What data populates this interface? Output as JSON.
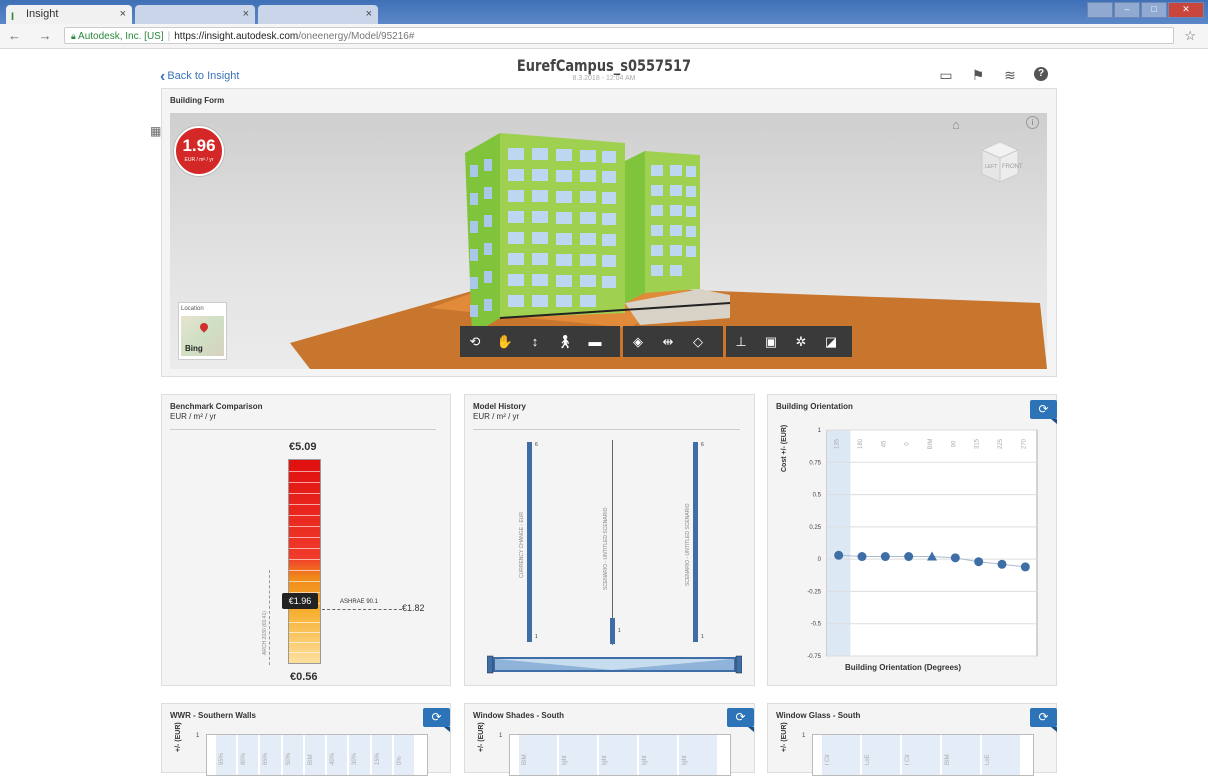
{
  "browser": {
    "tabs": [
      {
        "label": "Insight",
        "close": "×"
      },
      {
        "label": "",
        "close": "×"
      },
      {
        "label": "",
        "close": "×"
      }
    ],
    "nav_icons": "← → C",
    "url_org": "Autodesk, Inc. [US]",
    "url_sep": "|",
    "url_host": "https://insight.autodesk.com",
    "url_path": "/oneenergy/Model/95216#",
    "star": "☆"
  },
  "header": {
    "back_label": "Back to Insight",
    "title": "EurefCampus_s0557517",
    "date": "8.3.2018 - 12:04 AM"
  },
  "building_form": {
    "title": "Building Form",
    "eui_value": "1.96",
    "eui_unit": "EUR / m² / yr",
    "location_label": "Location",
    "bing_label": "Bing",
    "cube_front": "FRONT",
    "cube_left": "LEFT"
  },
  "benchmark": {
    "title": "Benchmark Comparison",
    "unit": "EUR / m² / yr",
    "top_value": "€5.09",
    "bottom_value": "€0.56",
    "current_value": "€1.96",
    "ashrae_label": "ASHRAE 90.1",
    "ashrae_value": "€1.82",
    "arch_label": "ARCH 2030 (€0.41)"
  },
  "history": {
    "title": "Model History",
    "unit": "EUR / m² / yr",
    "bars": [
      {
        "label": "CURRENCY CHANGE - EUR",
        "top": "6",
        "bottom": "1"
      },
      {
        "label": "SCENARIO - UNTITLED SCENARIO",
        "top": "",
        "bottom": "1"
      },
      {
        "label": "SCENARIO - UNTITLED SCENARIO",
        "top": "6",
        "bottom": "1"
      }
    ]
  },
  "orientation": {
    "title": "Building Orientation",
    "ylabel": "Cost +/- (EUR)",
    "xlabel": "Building Orientation (Degrees)"
  },
  "bottom_panels": [
    {
      "title": "WWR - Southern Walls",
      "ylabel": "+/- (EUR)",
      "ytop": "1",
      "cats": [
        "95%",
        "80%",
        "65%",
        "50%",
        "BIM",
        "40%",
        "30%",
        "15%",
        "0%"
      ]
    },
    {
      "title": "Window Shades - South",
      "ylabel": "+/- (EUR)",
      "ytop": "1",
      "cats": [
        "BIM",
        "ight",
        "ight",
        "ight",
        "ight"
      ]
    },
    {
      "title": "Window Glass - South",
      "ylabel": "+/- (EUR)",
      "ytop": "1",
      "cats": [
        "l Clr",
        "LoE",
        "l Clr",
        "BIM",
        "LoE"
      ]
    }
  ],
  "colors": {
    "accent": "#2d73b8",
    "eui_red": "#d42828",
    "bar_blue": "#3f6ea6",
    "building_green": "#8cc63f"
  },
  "chart_data": [
    {
      "type": "scatter",
      "title": "Building Orientation",
      "xlabel": "Building Orientation (Degrees)",
      "ylabel": "Cost +/- (EUR)",
      "categories": [
        "135",
        "180",
        "45",
        "0",
        "BIM",
        "90",
        "315",
        "225",
        "270"
      ],
      "values": [
        0.03,
        0.02,
        0.02,
        0.02,
        0.02,
        0.01,
        -0.02,
        -0.04,
        -0.06
      ],
      "ylim": [
        -0.75,
        1
      ],
      "yticks": [
        "1",
        "0.75",
        "0.5",
        "0.25",
        "0",
        "-0.25",
        "-0.5",
        "-0.75"
      ],
      "highlight_category": "135",
      "grid": true
    }
  ]
}
